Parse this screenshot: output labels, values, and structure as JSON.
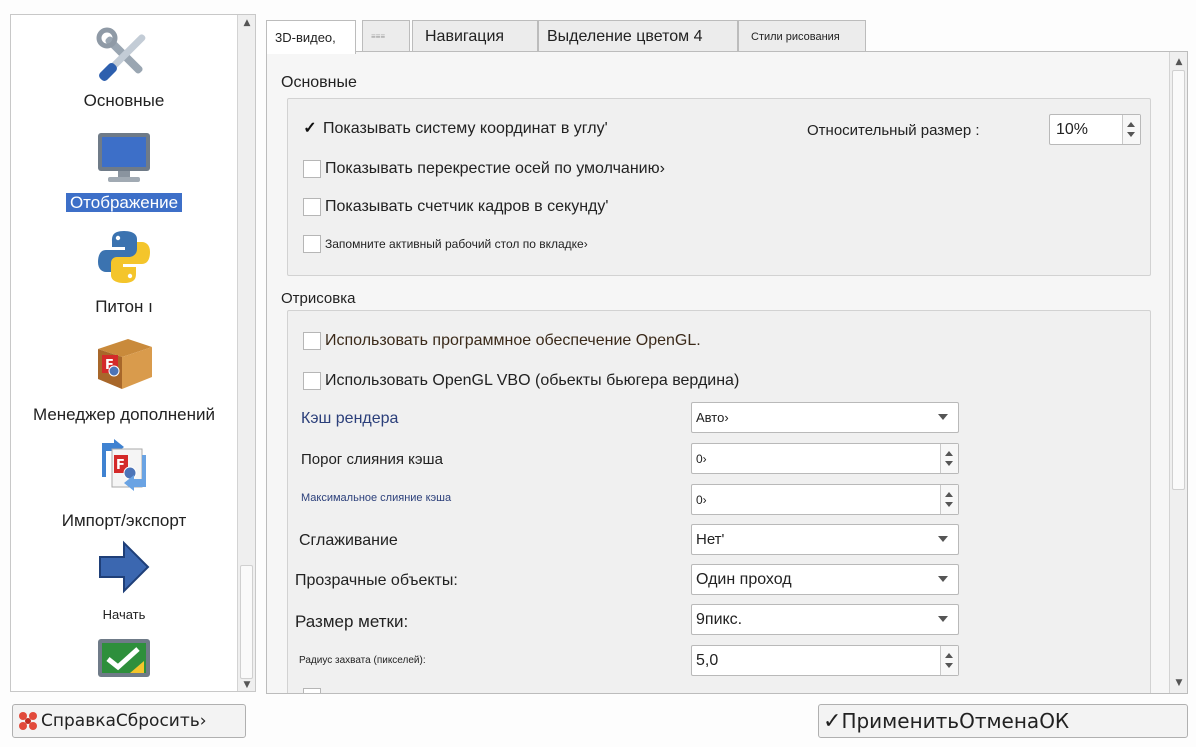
{
  "sidebar": {
    "items": [
      {
        "label": "Основные",
        "icon": "tools-icon"
      },
      {
        "label": "Отображение",
        "icon": "monitor-icon",
        "selected": true
      },
      {
        "label": "Питон ı",
        "icon": "python-icon"
      },
      {
        "label": "Менеджер дополнений",
        "icon": "addon-box-icon"
      },
      {
        "label": "Импорт/экспорт",
        "icon": "import-export-icon"
      },
      {
        "label": "Начать",
        "icon": "arrow-right-icon"
      },
      {
        "label": "",
        "icon": "monitor-check-icon"
      }
    ]
  },
  "tabs": [
    {
      "label": "3D-видео,",
      "active": true
    },
    {
      "label": "≡≡≡"
    },
    {
      "label": "Навигация"
    },
    {
      "label": "Выделение цветом 4"
    },
    {
      "label": "Стили рисования"
    }
  ],
  "general": {
    "title": "Основные",
    "show_axis_label": "Показывать систему координат в углу'",
    "show_axis_checked": true,
    "relative_size_label": "Относительный размер :",
    "relative_size_value": "10%",
    "show_cross_label": "Показывать перекрестие осей по умолчанию›",
    "show_fps_label": "Показывать счетчик кадров в секунду'",
    "remember_ws_label": "Запомните активный рабочий стол по вкладке›"
  },
  "render": {
    "title": "Отрисовка",
    "software_gl_label": "Использовать программное обеспечение OpenGL.",
    "vbo_label": "Использовать OpenGL VBO (обьекты бьюгера вердина)",
    "cache_label": "Кэш рендера",
    "cache_value": "Авто›",
    "merge_threshold_label": "Порог слияния кэша",
    "merge_threshold_value": "0›",
    "max_merge_label": "Максимальное слияние кэша",
    "max_merge_value": "0›",
    "aa_label": "Сглаживание",
    "aa_value": "Нет'",
    "transparent_label": "Прозрачные объекты:",
    "transparent_value": "Один проход",
    "marker_label": "Размер метки:",
    "marker_value": "9пикс.",
    "pick_radius_label": "Радиус захвата (пикселей):",
    "pick_radius_value": "5,0"
  },
  "buttons": {
    "help_reset": "СправкаСбросить›",
    "apply_cancel_ok": "ПрименитьОтменаОК"
  },
  "colors": {
    "selection": "#3d6fc8",
    "label_blue": "#2b3f7a"
  }
}
